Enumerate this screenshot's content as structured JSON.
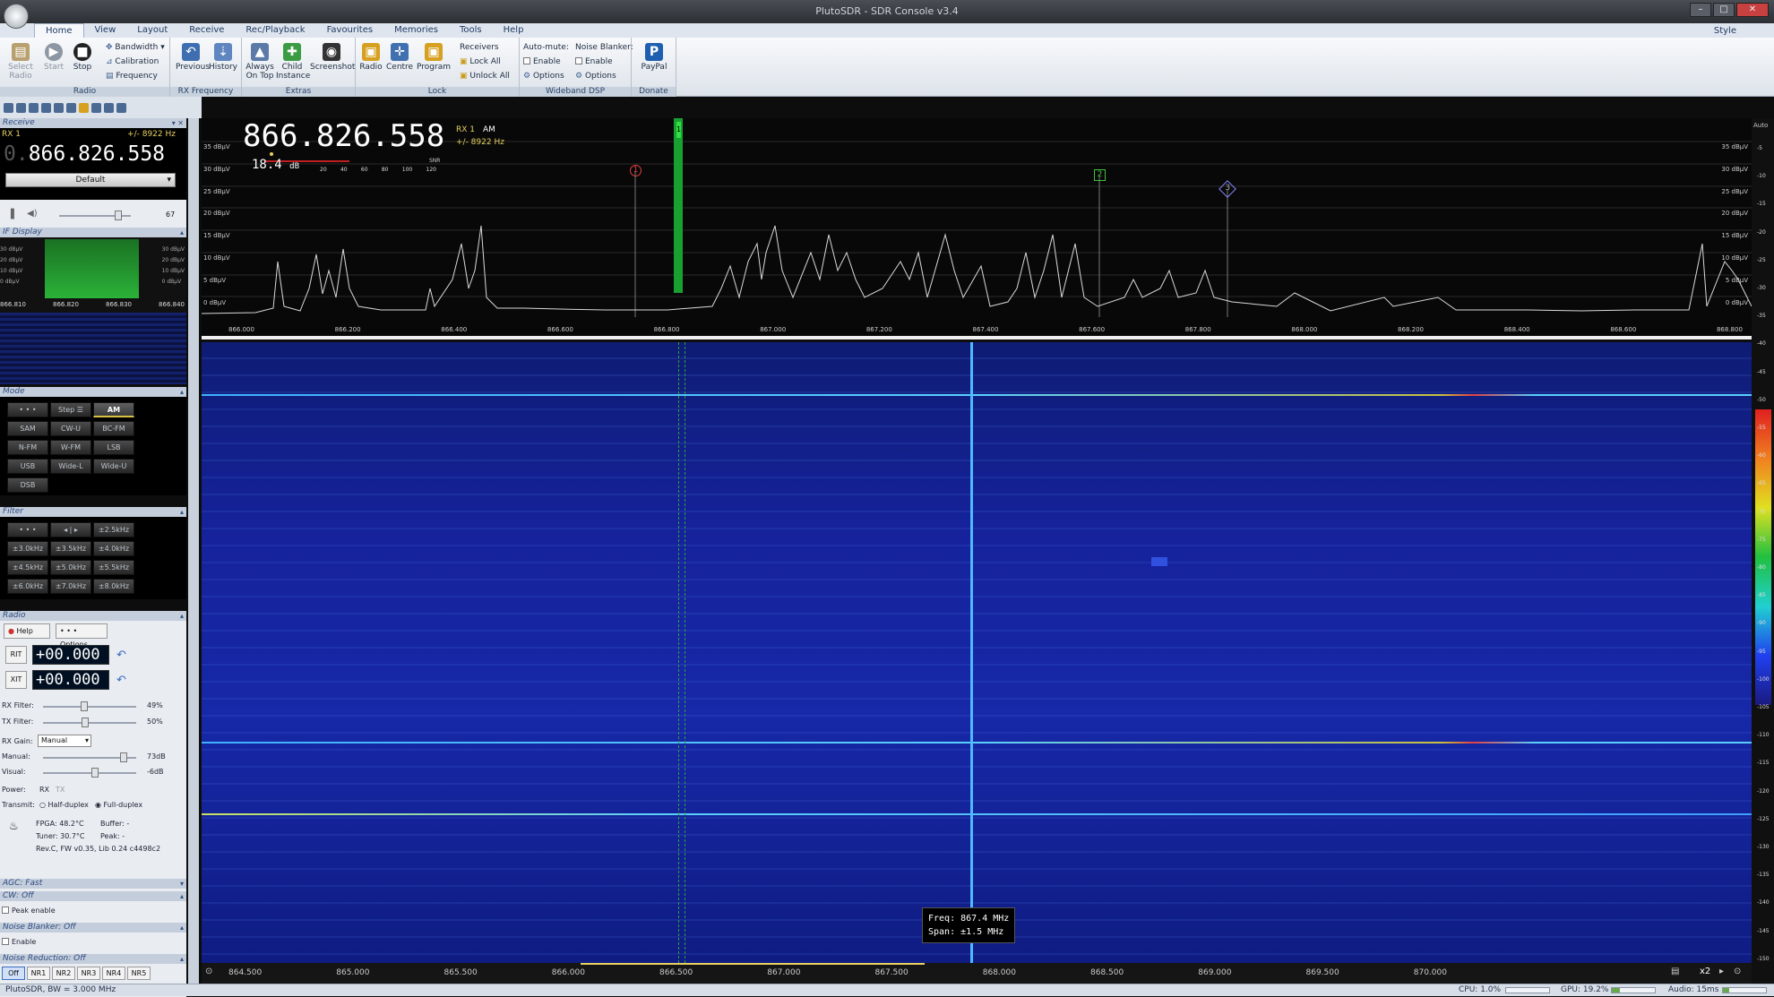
{
  "title": "PlutoSDR - SDR Console v3.4",
  "menu": [
    "Home",
    "View",
    "Layout",
    "Receive",
    "Rec/Playback",
    "Favourites",
    "Memories",
    "Tools",
    "Help"
  ],
  "style_label": "Style",
  "ribbon": {
    "radio": {
      "label": "Radio",
      "select_radio": "Select Radio",
      "start": "Start",
      "stop": "Stop",
      "bandwidth": "Bandwidth",
      "calibration": "Calibration",
      "frequency": "Frequency"
    },
    "rxfreq": {
      "label": "RX Frequency",
      "previous": "Previous",
      "history": "History"
    },
    "extras": {
      "label": "Extras",
      "always_on_top": "Always On Top",
      "child_instance": "Child Instance",
      "screenshot": "Screenshot"
    },
    "lock": {
      "label": "Lock",
      "radio": "Radio",
      "centre": "Centre",
      "program": "Program",
      "receivers": "Receivers",
      "lock_all": "Lock All",
      "unlock_all": "Unlock All"
    },
    "wideband": {
      "label": "Wideband DSP",
      "auto_mute": "Auto-mute:",
      "enable": "Enable",
      "options": "Options",
      "noise_blanker": "Noise Blanker:",
      "nb_enable": "Enable",
      "nb_options": "Options"
    },
    "donate": {
      "label": "Donate",
      "paypal": "PayPal"
    }
  },
  "receive": {
    "panel_title": "Receive",
    "rx_label": "RX 1",
    "offset": "+/- 8922 Hz",
    "frequency_prefix": "0.",
    "frequency": "866.826.558",
    "preset": "Default",
    "volume": "67"
  },
  "if_display": {
    "title": "IF Display",
    "levels": [
      "30 dBµV",
      "20 dBµV",
      "10 dBµV",
      "0 dBµV"
    ],
    "axis": [
      "866.810",
      "866.820",
      "866.830",
      "866.840"
    ]
  },
  "mode": {
    "title": "Mode",
    "buttons": [
      "• • •",
      "Step ☰",
      "AM",
      "SAM",
      "CW-U",
      "BC-FM",
      "N-FM",
      "W-FM",
      "LSB",
      "USB",
      "Wide-L",
      "Wide-U",
      "DSB"
    ],
    "selected": "AM"
  },
  "filter": {
    "title": "Filter",
    "buttons": [
      "• • •",
      "◂ | ▸",
      "±2.5kHz",
      "±3.0kHz",
      "±3.5kHz",
      "±4.0kHz",
      "±4.5kHz",
      "±5.0kHz",
      "±5.5kHz",
      "±6.0kHz",
      "±7.0kHz",
      "±8.0kHz"
    ]
  },
  "radio": {
    "title": "Radio",
    "help": "Help",
    "options": "• • • Options",
    "rit": "RIT",
    "xit": "XIT",
    "rit_value": "+00.000",
    "xit_value": "+00.000",
    "rx_filter": "RX Filter:",
    "rx_filter_value": "49%",
    "tx_filter": "TX Filter:",
    "tx_filter_value": "50%",
    "rx_gain": "RX Gain:",
    "rx_gain_mode": "Manual",
    "manual": "Manual:",
    "manual_value": "73dB",
    "visual": "Visual:",
    "visual_value": "-6dB",
    "power": "Power:",
    "power_rx": "RX",
    "power_tx": "TX",
    "transmit": "Transmit:",
    "half_duplex": "Half-duplex",
    "full_duplex": "Full-duplex",
    "fpga": "FPGA: 48.2°C",
    "tuner": "Tuner: 30.7°C",
    "buffer": "Buffer: -",
    "peak": "Peak: -",
    "rev": "Rev.C, FW v0.35, Lib 0.24 c4498c2"
  },
  "agc": {
    "title": "AGC: Fast"
  },
  "cw": {
    "title": "CW: Off",
    "peak_enable": "Peak enable"
  },
  "nb": {
    "title": "Noise Blanker: Off",
    "enable": "Enable"
  },
  "nr": {
    "title": "Noise Reduction: Off",
    "buttons": [
      "Off",
      "NR1",
      "NR2",
      "NR3",
      "NR4",
      "NR5"
    ]
  },
  "spectrum": {
    "frequency": "866.826.558",
    "rx": "RX 1",
    "mode": "AM",
    "offset": "+/- 8922 Hz",
    "snr_value": "18.4",
    "snr_unit": "dB",
    "snr_label": "SNR",
    "snr_scale": [
      "20",
      "40",
      "60",
      "80",
      "100",
      "120"
    ],
    "levels": [
      "35 dBµV",
      "30 dBµV",
      "25 dBµV",
      "20 dBµV",
      "15 dBµV",
      "10 dBµV",
      "5 dBµV",
      "0 dBµV"
    ],
    "axis": [
      "866.000",
      "866.200",
      "866.400",
      "866.600",
      "866.800",
      "867.000",
      "867.200",
      "867.400",
      "867.600",
      "867.800",
      "868.000",
      "868.200",
      "868.400",
      "868.600",
      "868.800"
    ],
    "markers": [
      "1",
      "2",
      "3"
    ],
    "rx_marker": "1",
    "auto_label": "Auto"
  },
  "waterfall": {
    "axis": [
      "864.500",
      "865.000",
      "865.500",
      "866.000",
      "866.500",
      "867.000",
      "867.500",
      "868.000",
      "868.500",
      "869.000",
      "869.500",
      "870.000"
    ],
    "tooltip_freq": "Freq:  867.4 MHz",
    "tooltip_span": "Span:  ±1.5 MHz",
    "zoom": "x2"
  },
  "scale": [
    "-5",
    "-10",
    "-15",
    "-20",
    "-25",
    "-30",
    "-35",
    "-40",
    "-45",
    "-50",
    "-55",
    "-60",
    "-65",
    "-70",
    "-75",
    "-80",
    "-85",
    "-90",
    "-95",
    "-100",
    "-105",
    "-110",
    "-115",
    "-120",
    "-125",
    "-130",
    "-135",
    "-140",
    "-145",
    "-150"
  ],
  "status": {
    "left": "PlutoSDR, BW = 3.000 MHz",
    "cpu": "CPU: 1.0%",
    "gpu": "GPU: 19.2%",
    "audio": "Audio: 15ms"
  }
}
